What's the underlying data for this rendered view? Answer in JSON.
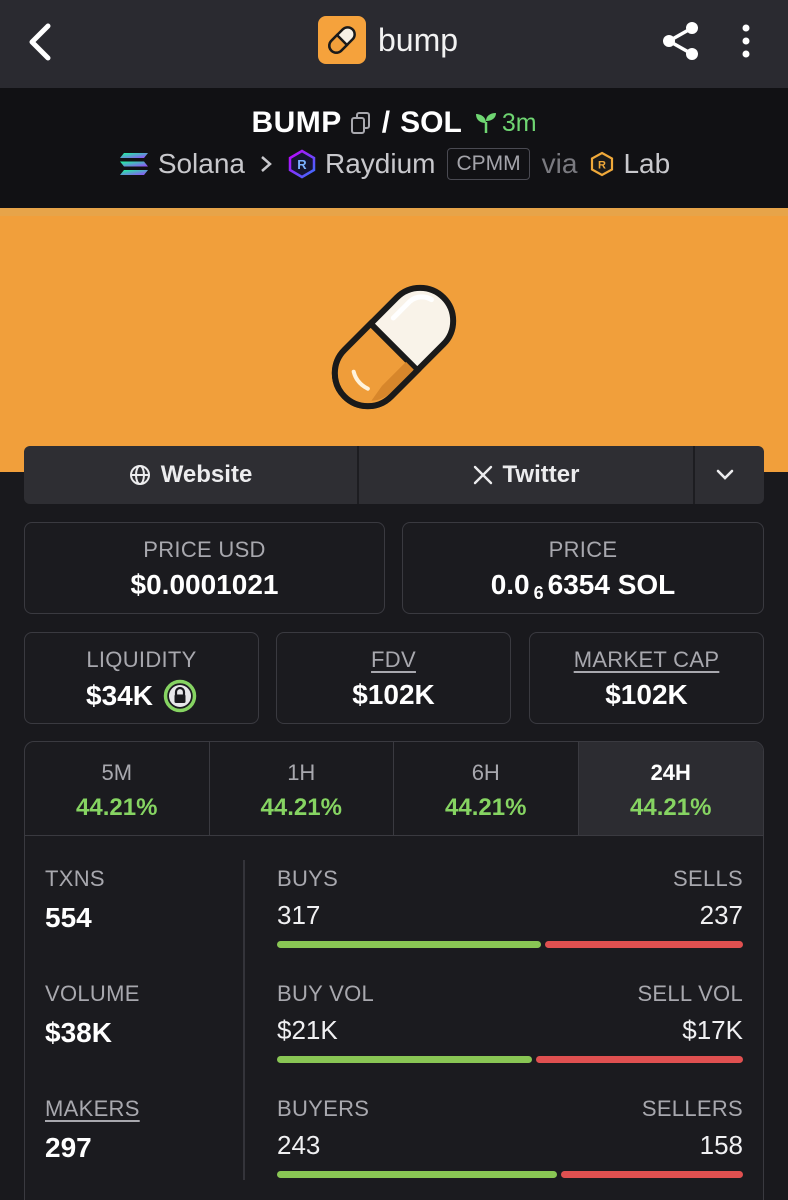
{
  "app": {
    "name": "bump"
  },
  "pair": {
    "base": "BUMP",
    "separator": "/",
    "quote": "SOL",
    "age": "3m",
    "chain": "Solana",
    "dex": "Raydium",
    "pool_type": "CPMM",
    "via": "via",
    "launchpad": "Lab"
  },
  "links": {
    "website": "Website",
    "twitter": "Twitter"
  },
  "price_usd": {
    "label": "PRICE USD",
    "value": "$0.0001021"
  },
  "price": {
    "label": "PRICE",
    "prefix": "0.0",
    "zeros": "6",
    "suffix": "6354 SOL"
  },
  "liquidity": {
    "label": "LIQUIDITY",
    "value": "$34K"
  },
  "fdv": {
    "label": "FDV",
    "value": "$102K"
  },
  "market_cap": {
    "label": "MARKET CAP",
    "value": "$102K"
  },
  "timeframes": [
    {
      "label": "5M",
      "change": "44.21%"
    },
    {
      "label": "1H",
      "change": "44.21%"
    },
    {
      "label": "6H",
      "change": "44.21%"
    },
    {
      "label": "24H",
      "change": "44.21%"
    }
  ],
  "metrics": {
    "txns": {
      "label": "TXNS",
      "value": "554"
    },
    "volume": {
      "label": "VOLUME",
      "value": "$38K"
    },
    "makers": {
      "label": "MAKERS",
      "value": "297"
    }
  },
  "splits": {
    "txns": {
      "left_label": "BUYS",
      "right_label": "SELLS",
      "left_value": "317",
      "right_value": "237",
      "left_share": 0.572
    },
    "volume": {
      "left_label": "BUY VOL",
      "right_label": "SELL VOL",
      "left_value": "$21K",
      "right_value": "$17K",
      "left_share": 0.553
    },
    "makers": {
      "left_label": "BUYERS",
      "right_label": "SELLERS",
      "left_value": "243",
      "right_value": "158",
      "left_share": 0.606
    }
  },
  "colors": {
    "accent_orange": "#f19f3b",
    "positive": "#86d462",
    "buy_bar": "#89c654",
    "sell_bar": "#e05050"
  }
}
